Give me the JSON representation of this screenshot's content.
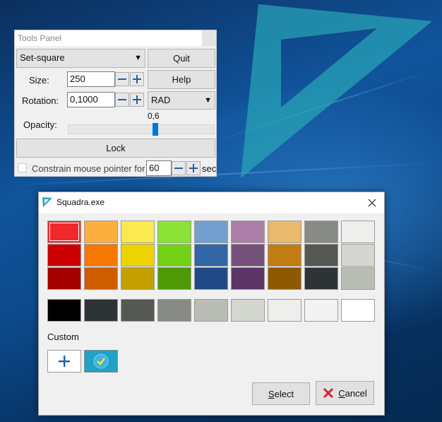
{
  "colors": {
    "accent": "#0078d7",
    "setsquare": "#2aa6b8",
    "dialog_bg": "#f0f0f0",
    "custom_swatch": "#1fa1c8",
    "cancel_x": "#d9202a"
  },
  "tools_panel": {
    "title": "Tools Panel",
    "shape_select": {
      "value": "Set-square",
      "icon": "dropdown-arrow-icon"
    },
    "quit_label": "Quit",
    "help_label": "Help",
    "size": {
      "label": "Size:",
      "value": "250"
    },
    "rotation": {
      "label": "Rotation:",
      "value": "0,1000"
    },
    "unit_select": {
      "value": "RAD"
    },
    "opacity": {
      "label": "Opacity:",
      "value": "0,6",
      "level": 0.6
    },
    "lock_label": "Lock",
    "constrain": {
      "label": "Constrain mouse pointer for",
      "value": "60",
      "unit": "sec",
      "checked": false
    }
  },
  "squadra_dialog": {
    "title": "Squadra.exe",
    "swatch_rows": [
      [
        "#ef2929",
        "#fcaf3e",
        "#fce94f",
        "#8ae234",
        "#729fcf",
        "#ad7fa8",
        "#e9b96e",
        "#888a85",
        "#eeeeec"
      ],
      [
        "#cc0000",
        "#f57900",
        "#edd400",
        "#73d216",
        "#3465a4",
        "#75507b",
        "#c17d11",
        "#555753",
        "#d3d7cf"
      ],
      [
        "#a40000",
        "#ce5c00",
        "#c4a000",
        "#4e9a06",
        "#204a87",
        "#5c3566",
        "#8f5902",
        "#2e3436",
        "#babdb6"
      ]
    ],
    "gray_row": [
      "#000000",
      "#2e3436",
      "#555753",
      "#888a85",
      "#babdb6",
      "#d3d7cf",
      "#eeeeec",
      "#f3f3f3",
      "#ffffff"
    ],
    "selected_swatch": "#ef2929",
    "custom_label": "Custom",
    "custom_swatches": [
      "#1fa1c8"
    ],
    "select_button": {
      "mnemonic": "S",
      "rest": "elect"
    },
    "cancel_button": {
      "mnemonic": "C",
      "rest": "ancel"
    }
  }
}
